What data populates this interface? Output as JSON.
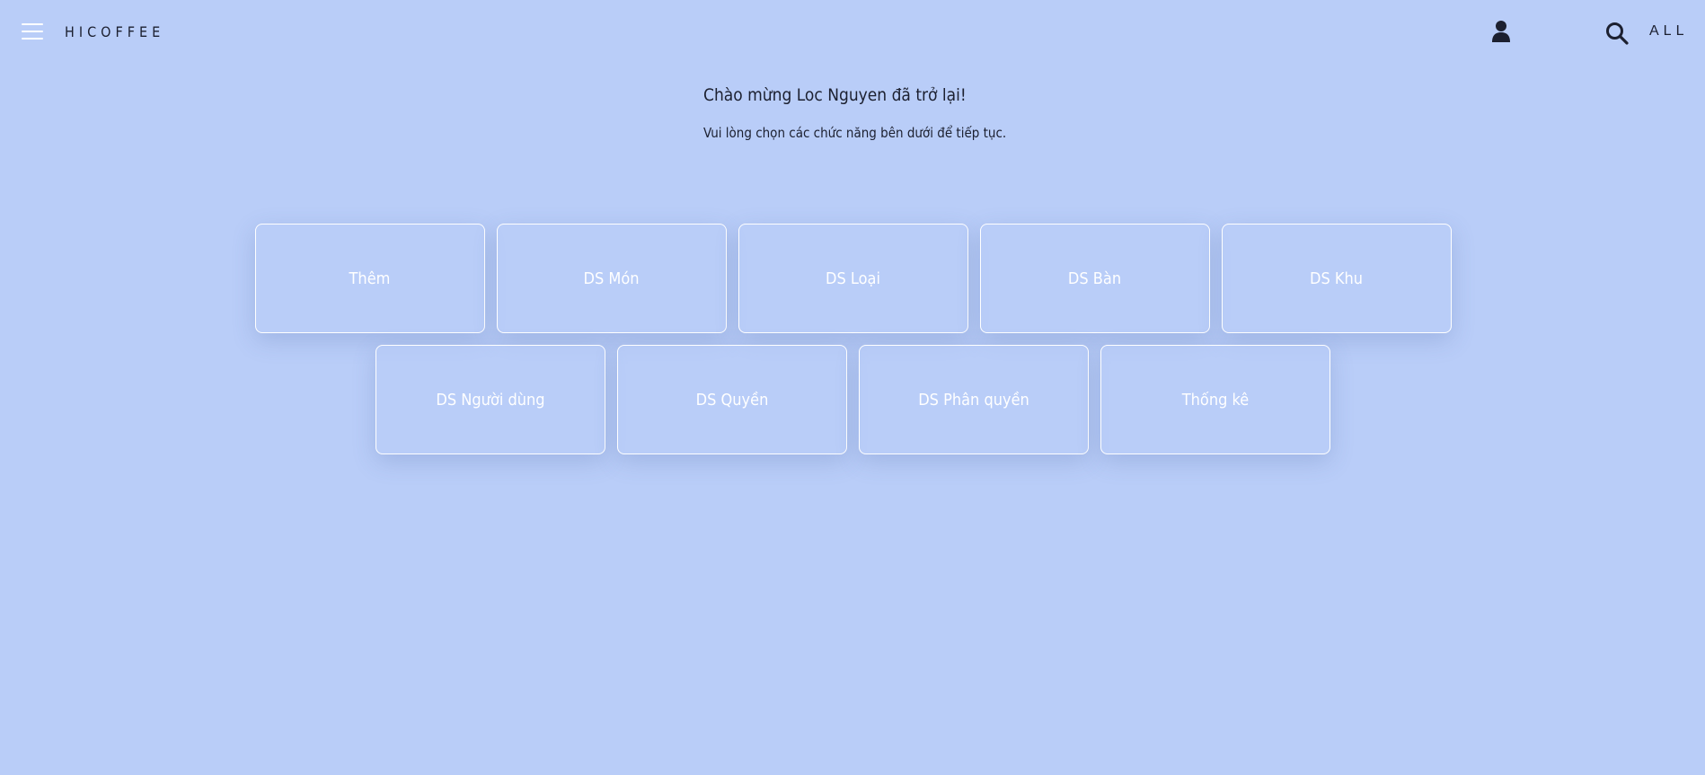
{
  "header": {
    "brand": "HICOFFEE",
    "all_label": "ALL",
    "icons": {
      "menu": "hamburger-menu-icon",
      "user": "user-icon",
      "search": "search-icon"
    }
  },
  "main": {
    "welcome": "Chào mừng Loc Nguyen đã trở lại!",
    "subtitle": "Vui lòng chọn các chức năng bên dưới để tiếp tục."
  },
  "tiles": {
    "row1": [
      "Thêm",
      "DS Món",
      "DS Loại",
      "DS Bàn",
      "DS Khu"
    ],
    "row2": [
      "DS Người dùng",
      "DS Quyền",
      "DS Phân quyền",
      "Thống kê"
    ]
  },
  "colors": {
    "background": "#b9cdf8",
    "text": "#1c2030",
    "tile_border": "#ffffff",
    "tile_text": "#ffffff"
  }
}
